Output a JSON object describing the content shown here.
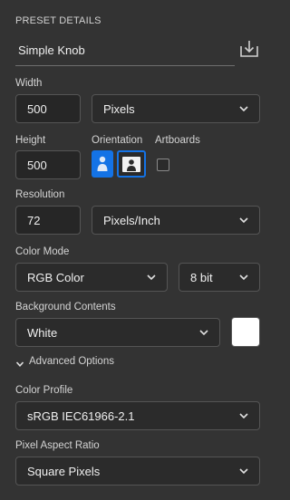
{
  "header": {
    "title": "PRESET DETAILS"
  },
  "preset": {
    "name": "Simple Knob",
    "save_icon": "save-preset-icon"
  },
  "width": {
    "label": "Width",
    "value": "500",
    "unit": "Pixels"
  },
  "height": {
    "label": "Height",
    "value": "500"
  },
  "orientation": {
    "label": "Orientation",
    "selected": "landscape"
  },
  "artboards": {
    "label": "Artboards",
    "checked": false
  },
  "resolution": {
    "label": "Resolution",
    "value": "72",
    "unit": "Pixels/Inch"
  },
  "color_mode": {
    "label": "Color Mode",
    "mode": "RGB Color",
    "depth": "8 bit"
  },
  "background": {
    "label": "Background Contents",
    "value": "White",
    "swatch_color": "#ffffff"
  },
  "advanced": {
    "label": "Advanced Options",
    "expanded": true
  },
  "color_profile": {
    "label": "Color Profile",
    "value": "sRGB IEC61966-2.1"
  },
  "pixel_aspect": {
    "label": "Pixel Aspect Ratio",
    "value": "Square Pixels"
  },
  "colors": {
    "accent": "#1473e6",
    "panel": "#333333",
    "field": "#262626"
  }
}
